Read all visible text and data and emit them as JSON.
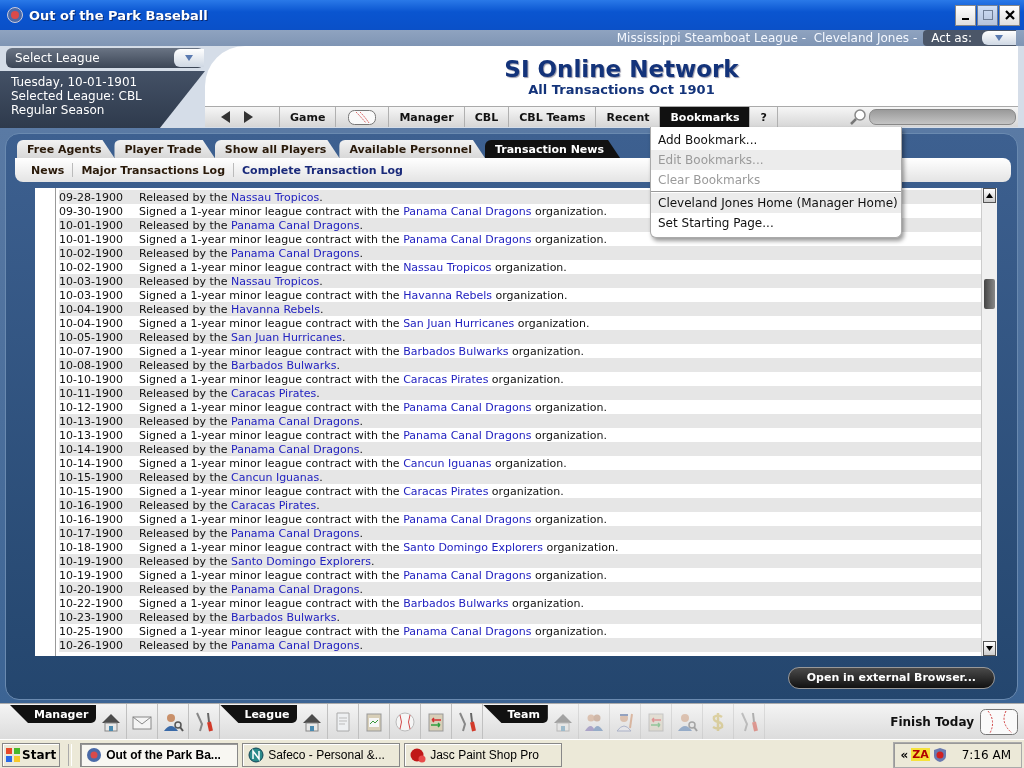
{
  "window": {
    "title": "Out of the Park Baseball"
  },
  "header": {
    "context": "Mississippi Steamboat League -  Cleveland Jones -",
    "act_as": "Act as:",
    "league_select": "Select League",
    "date": "Tuesday, 10-01-1901",
    "selected_league": "Selected League: CBL",
    "season": "Regular Season",
    "title": "SI Online Network",
    "subtitle": "All Transactions Oct 1901"
  },
  "nav": [
    {
      "kind": "label",
      "label": "Game",
      "selected": false
    },
    {
      "kind": "ball",
      "selected": false
    },
    {
      "kind": "label",
      "label": "Manager",
      "selected": false
    },
    {
      "kind": "label",
      "label": "CBL",
      "selected": false
    },
    {
      "kind": "label",
      "label": "CBL Teams",
      "selected": false
    },
    {
      "kind": "label",
      "label": "Recent",
      "selected": false
    },
    {
      "kind": "label",
      "label": "Bookmarks",
      "selected": true
    },
    {
      "kind": "label",
      "label": "?",
      "selected": false
    }
  ],
  "bookmarks_menu": {
    "items": [
      {
        "kind": "item",
        "label": "Add Bookmark...",
        "disabled": false
      },
      {
        "kind": "item",
        "label": "Edit Bookmarks...",
        "disabled": true
      },
      {
        "kind": "item",
        "label": "Clear Bookmarks",
        "disabled": true
      },
      {
        "kind": "separator"
      },
      {
        "kind": "item",
        "label": "Cleveland Jones Home (Manager Home)",
        "disabled": false
      },
      {
        "kind": "item",
        "label": "Set Starting Page...",
        "disabled": false
      }
    ]
  },
  "tabs": [
    {
      "label": "Free Agents",
      "selected": false
    },
    {
      "label": "Player Trade",
      "selected": false
    },
    {
      "label": "Show all Players",
      "selected": false
    },
    {
      "label": "Available Personnel",
      "selected": false
    },
    {
      "label": "Transaction News",
      "selected": true
    }
  ],
  "subtabs": [
    {
      "label": "News",
      "selected": false
    },
    {
      "label": "Major Transactions Log",
      "selected": false
    },
    {
      "label": "Complete Transaction Log",
      "selected": true
    }
  ],
  "transactions": [
    {
      "date": "09-28-1900",
      "before": "Released by the",
      "team": "Nassau Tropicos",
      "after": "."
    },
    {
      "date": "09-30-1900",
      "before": "Signed a 1-year minor league contract with the",
      "team": "Panama Canal Dragons",
      "after": " organization."
    },
    {
      "date": "10-01-1900",
      "before": "Released by the",
      "team": "Panama Canal Dragons",
      "after": "."
    },
    {
      "date": "10-01-1900",
      "before": "Signed a 1-year minor league contract with the",
      "team": "Panama Canal Dragons",
      "after": " organization."
    },
    {
      "date": "10-02-1900",
      "before": "Released by the",
      "team": "Panama Canal Dragons",
      "after": "."
    },
    {
      "date": "10-02-1900",
      "before": "Signed a 1-year minor league contract with the",
      "team": "Nassau Tropicos",
      "after": " organization."
    },
    {
      "date": "10-03-1900",
      "before": "Released by the",
      "team": "Nassau Tropicos",
      "after": "."
    },
    {
      "date": "10-03-1900",
      "before": "Signed a 1-year minor league contract with the",
      "team": "Havanna Rebels",
      "after": " organization."
    },
    {
      "date": "10-04-1900",
      "before": "Released by the",
      "team": "Havanna Rebels",
      "after": "."
    },
    {
      "date": "10-04-1900",
      "before": "Signed a 1-year minor league contract with the",
      "team": "San Juan Hurricanes",
      "after": " organization."
    },
    {
      "date": "10-05-1900",
      "before": "Released by the",
      "team": "San Juan Hurricanes",
      "after": "."
    },
    {
      "date": "10-07-1900",
      "before": "Signed a 1-year minor league contract with the",
      "team": "Barbados Bulwarks",
      "after": " organization."
    },
    {
      "date": "10-08-1900",
      "before": "Released by the",
      "team": "Barbados Bulwarks",
      "after": "."
    },
    {
      "date": "10-10-1900",
      "before": "Signed a 1-year minor league contract with the",
      "team": "Caracas Pirates",
      "after": " organization."
    },
    {
      "date": "10-11-1900",
      "before": "Released by the",
      "team": "Caracas Pirates",
      "after": "."
    },
    {
      "date": "10-12-1900",
      "before": "Signed a 1-year minor league contract with the",
      "team": "Panama Canal Dragons",
      "after": " organization."
    },
    {
      "date": "10-13-1900",
      "before": "Released by the",
      "team": "Panama Canal Dragons",
      "after": "."
    },
    {
      "date": "10-13-1900",
      "before": "Signed a 1-year minor league contract with the",
      "team": "Panama Canal Dragons",
      "after": " organization."
    },
    {
      "date": "10-14-1900",
      "before": "Released by the",
      "team": "Panama Canal Dragons",
      "after": "."
    },
    {
      "date": "10-14-1900",
      "before": "Signed a 1-year minor league contract with the",
      "team": "Cancun Iguanas",
      "after": " organization."
    },
    {
      "date": "10-15-1900",
      "before": "Released by the",
      "team": "Cancun Iguanas",
      "after": "."
    },
    {
      "date": "10-15-1900",
      "before": "Signed a 1-year minor league contract with the",
      "team": "Caracas Pirates",
      "after": " organization."
    },
    {
      "date": "10-16-1900",
      "before": "Released by the",
      "team": "Caracas Pirates",
      "after": "."
    },
    {
      "date": "10-16-1900",
      "before": "Signed a 1-year minor league contract with the",
      "team": "Panama Canal Dragons",
      "after": " organization."
    },
    {
      "date": "10-17-1900",
      "before": "Released by the",
      "team": "Panama Canal Dragons",
      "after": "."
    },
    {
      "date": "10-18-1900",
      "before": "Signed a 1-year minor league contract with the",
      "team": "Santo Domingo Explorers",
      "after": " organization."
    },
    {
      "date": "10-19-1900",
      "before": "Released by the",
      "team": "Santo Domingo Explorers",
      "after": "."
    },
    {
      "date": "10-19-1900",
      "before": "Signed a 1-year minor league contract with the",
      "team": "Panama Canal Dragons",
      "after": " organization."
    },
    {
      "date": "10-20-1900",
      "before": "Released by the",
      "team": "Panama Canal Dragons",
      "after": "."
    },
    {
      "date": "10-22-1900",
      "before": "Signed a 1-year minor league contract with the",
      "team": "Barbados Bulwarks",
      "after": " organization."
    },
    {
      "date": "10-23-1900",
      "before": "Released by the",
      "team": "Barbados Bulwarks",
      "after": "."
    },
    {
      "date": "10-25-1900",
      "before": "Signed a 1-year minor league contract with the",
      "team": "Panama Canal Dragons",
      "after": " organization."
    },
    {
      "date": "10-26-1900",
      "before": "Released by the",
      "team": "Panama Canal Dragons",
      "after": "."
    }
  ],
  "open_browser_button": "Open in external Browser...",
  "toolbar": {
    "groups": [
      {
        "label": "Manager",
        "buttons": [
          {
            "kind": "house",
            "disabled": false
          },
          {
            "kind": "envelope",
            "disabled": false
          },
          {
            "kind": "person-search",
            "disabled": false
          },
          {
            "kind": "tools",
            "disabled": false
          }
        ]
      },
      {
        "label": "League",
        "buttons": [
          {
            "kind": "house",
            "disabled": false
          },
          {
            "kind": "document",
            "disabled": false
          },
          {
            "kind": "clipboard",
            "disabled": false
          },
          {
            "kind": "ball",
            "disabled": false
          },
          {
            "kind": "clipboard-arrows",
            "disabled": false
          },
          {
            "kind": "tools",
            "disabled": false
          }
        ]
      },
      {
        "label": "Team",
        "buttons": [
          {
            "kind": "house",
            "disabled": true
          },
          {
            "kind": "people",
            "disabled": true
          },
          {
            "kind": "player",
            "disabled": true
          },
          {
            "kind": "clipboard-arrows",
            "disabled": true
          },
          {
            "kind": "person-search",
            "disabled": true
          },
          {
            "kind": "dollar",
            "disabled": true
          },
          {
            "kind": "tools",
            "disabled": true
          }
        ]
      }
    ],
    "finish_today": "Finish Today"
  },
  "taskbar": {
    "start": "Start",
    "tasks": [
      {
        "kind": "ootp",
        "label": "Out of the Park Ba...",
        "selected": true
      },
      {
        "kind": "netscape",
        "label": "Safeco - Personal &...",
        "selected": false
      },
      {
        "kind": "psp",
        "label": "Jasc Paint Shop Pro",
        "selected": false
      }
    ],
    "tray_expand": "«",
    "tray_badge": "ZA",
    "clock": "7:16 AM"
  }
}
